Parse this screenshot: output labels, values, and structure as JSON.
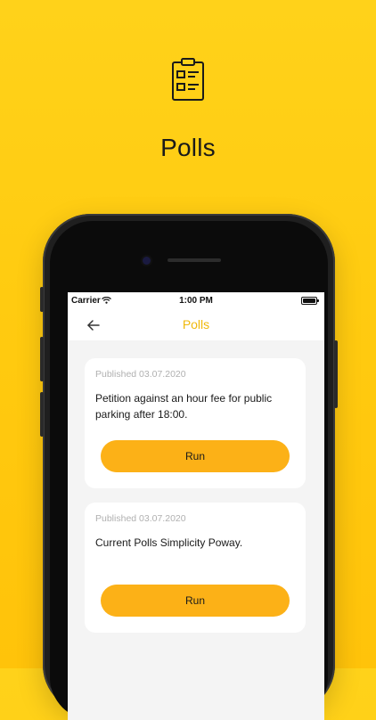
{
  "hero": {
    "title": "Polls",
    "icon": "clipboard-list-icon"
  },
  "statusbar": {
    "carrier": "Carrier",
    "time": "1:00 PM"
  },
  "navbar": {
    "title": "Polls",
    "back_icon": "arrow-left-icon"
  },
  "polls": [
    {
      "published": "Published 03.07.2020",
      "text": "Petition against an hour fee for public parking after 18:00.",
      "run_label": "Run"
    },
    {
      "published": "Published 03.07.2020",
      "text": "Current Polls Simplicity Poway.",
      "run_label": "Run"
    }
  ],
  "colors": {
    "background": "#FFCB10",
    "accent": "#F0B90B",
    "button": "#FCB117"
  }
}
